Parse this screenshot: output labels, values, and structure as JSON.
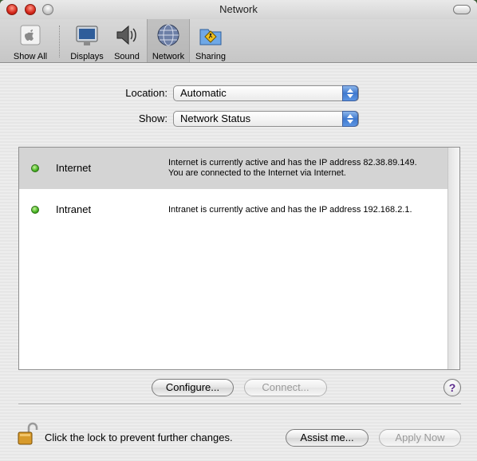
{
  "window": {
    "title": "Network"
  },
  "toolbar": {
    "items": [
      {
        "label": "Show All",
        "icon": "apple-icon"
      },
      {
        "label": "Displays",
        "icon": "display-icon"
      },
      {
        "label": "Sound",
        "icon": "speaker-icon"
      },
      {
        "label": "Network",
        "icon": "network-globe-icon",
        "selected": true
      },
      {
        "label": "Sharing",
        "icon": "sharing-folder-icon"
      }
    ]
  },
  "form": {
    "location_label": "Location:",
    "location_value": "Automatic",
    "show_label": "Show:",
    "show_value": "Network Status"
  },
  "status": {
    "rows": [
      {
        "name": "Internet",
        "desc_line1": "Internet is currently active and has the IP address 82.38.89.149.",
        "desc_line2": "You are connected to the Internet via Internet.",
        "status_color": "#44b220",
        "selected": true
      },
      {
        "name": "Intranet",
        "desc_line1": "Intranet is currently active and has the IP address 192.168.2.1.",
        "desc_line2": "",
        "status_color": "#44b220",
        "selected": false
      }
    ]
  },
  "buttons": {
    "configure": "Configure...",
    "connect": "Connect...",
    "help": "?",
    "assist": "Assist me...",
    "apply": "Apply Now"
  },
  "footer": {
    "lock_text": "Click the lock to prevent further changes."
  },
  "colors": {
    "selection": "#d4d4d4",
    "status_green": "#44b220"
  }
}
